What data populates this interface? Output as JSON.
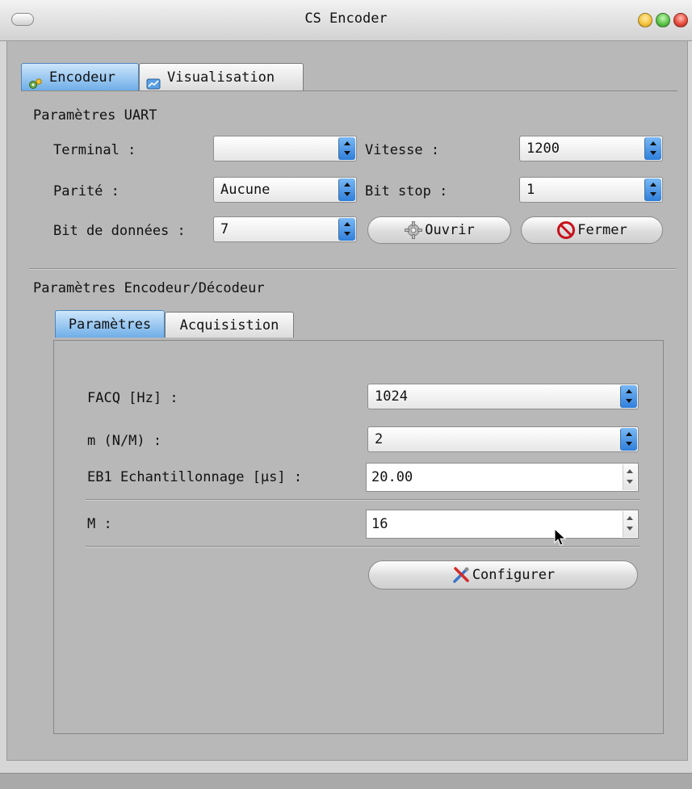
{
  "window": {
    "title": "CS Encoder",
    "traffic_lights": [
      {
        "name": "minimize",
        "color": "#f5c542"
      },
      {
        "name": "zoom",
        "color": "#5cc44b"
      },
      {
        "name": "close",
        "color": "#e84c3d"
      }
    ]
  },
  "main_tabs": [
    {
      "label": "Encodeur",
      "icon": "gears-icon",
      "active": true
    },
    {
      "label": "Visualisation",
      "icon": "chart-icon",
      "active": false
    }
  ],
  "uart": {
    "section_title": "Paramètres UART",
    "terminal": {
      "label": "Terminal :",
      "value": ""
    },
    "vitesse": {
      "label": "Vitesse :",
      "value": "1200"
    },
    "parite": {
      "label": "Parité :",
      "value": "Aucune"
    },
    "bit_stop": {
      "label": "Bit stop :",
      "value": "1"
    },
    "bit_donnees": {
      "label": "Bit de données :",
      "value": "7"
    },
    "open_button": {
      "label": "Ouvrir",
      "icon": "gear-icon"
    },
    "close_button": {
      "label": "Fermer",
      "icon": "no-entry-icon"
    }
  },
  "encoder": {
    "section_title": "Paramètres Encodeur/Décodeur",
    "tabs": [
      {
        "label": "Paramètres",
        "active": true
      },
      {
        "label": "Acquisistion",
        "active": false
      }
    ],
    "facq": {
      "label": "FACQ [Hz] :",
      "value": "1024"
    },
    "m_ratio": {
      "label": "m (N/M) :",
      "value": "2"
    },
    "eb1": {
      "label": "EB1 Echantillonnage [µs] :",
      "value": "20.00"
    },
    "M": {
      "label": "M :",
      "value": "16"
    },
    "configure_button": {
      "label": "Configurer",
      "icon": "tools-icon"
    }
  },
  "colors": {
    "accent_blue": "#3d8ee6",
    "window_bg": "#b8b8b8"
  }
}
